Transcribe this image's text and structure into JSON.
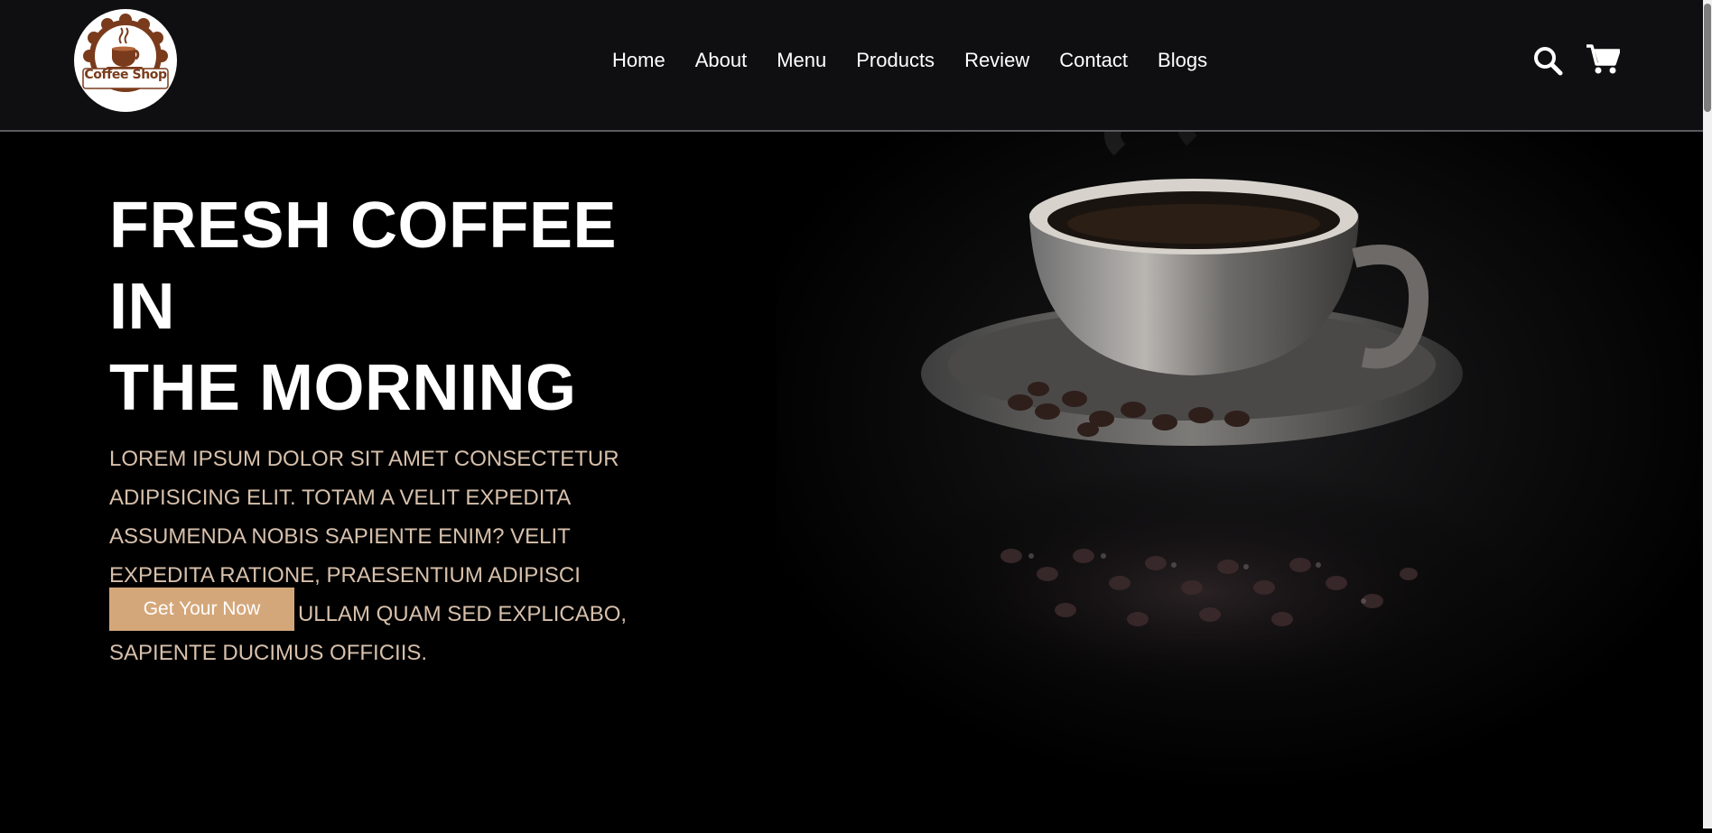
{
  "brand": {
    "logo_text": "Coffee Shop"
  },
  "nav": {
    "links": [
      "Home",
      "About",
      "Menu",
      "Products",
      "Review",
      "Contact",
      "Blogs"
    ]
  },
  "icons": {
    "search": "search-icon",
    "cart": "shopping-cart-icon"
  },
  "hero": {
    "title_line1": "FRESH COFFEE IN",
    "title_line2": "THE MORNING",
    "description": "LOREM IPSUM DOLOR SIT AMET CONSECTETUR ADIPISICING ELIT. TOTAM A VELIT EXPEDITA ASSUMENDA NOBIS SAPIENTE ENIM? VELIT EXPEDITA RATIONE, PRAESENTIUM ADIPISCI SOLUTA FACERE, ULLAM QUAM SED EXPLICABO, SAPIENTE DUCIMUS OFFICIIS.",
    "cta_label": "Get Your Now"
  },
  "colors": {
    "navbar_bg": "#0f0f12",
    "page_bg": "#000000",
    "accent": "#d4a77a",
    "logo_brown": "#7a3b1c"
  }
}
